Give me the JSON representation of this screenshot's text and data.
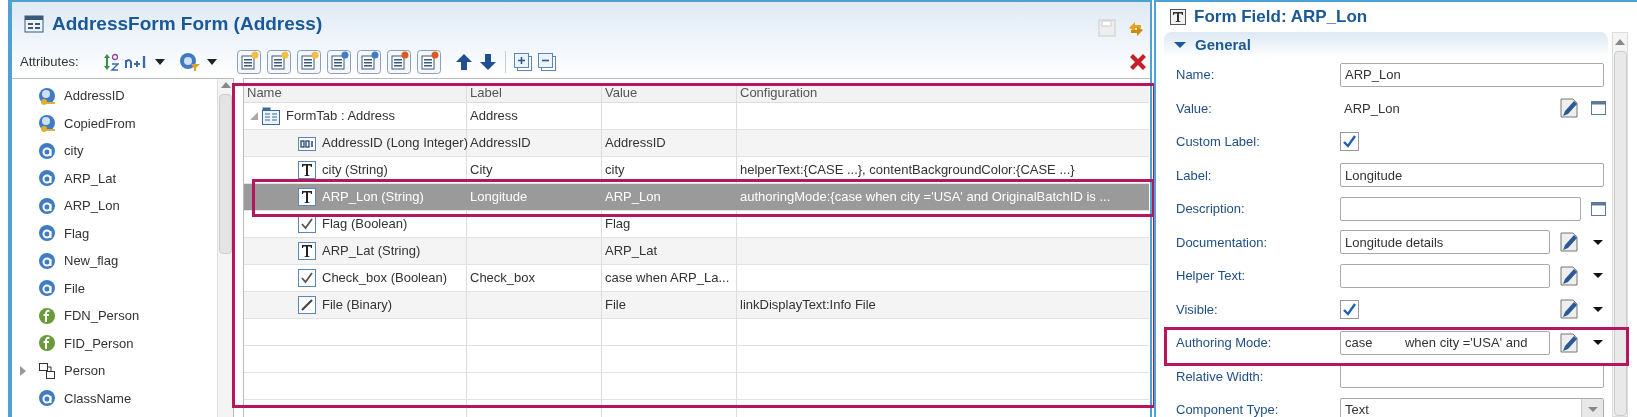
{
  "editor": {
    "title": "AddressForm Form (Address)",
    "attributes_label": "Attributes:"
  },
  "attributes": [
    {
      "name": "AddressID",
      "kind": "key",
      "expandable": false
    },
    {
      "name": "CopiedFrom",
      "kind": "key",
      "expandable": false
    },
    {
      "name": "city",
      "kind": "attribute",
      "expandable": false
    },
    {
      "name": "ARP_Lat",
      "kind": "attribute",
      "expandable": false
    },
    {
      "name": "ARP_Lon",
      "kind": "attribute",
      "expandable": false
    },
    {
      "name": "Flag",
      "kind": "attribute",
      "expandable": false
    },
    {
      "name": "New_flag",
      "kind": "attribute",
      "expandable": false
    },
    {
      "name": "File",
      "kind": "attribute",
      "expandable": false
    },
    {
      "name": "FDN_Person",
      "kind": "formula",
      "expandable": false
    },
    {
      "name": "FID_Person",
      "kind": "formula",
      "expandable": false
    },
    {
      "name": "Person",
      "kind": "relation",
      "expandable": true
    },
    {
      "name": "ClassName",
      "kind": "attribute",
      "expandable": false
    }
  ],
  "grid": {
    "columns": [
      "Name",
      "Label",
      "Value",
      "Configuration"
    ],
    "rows": [
      {
        "name": "FormTab : Address",
        "label": "Address",
        "kind": "tab",
        "selected": false,
        "expanded": true,
        "children": [
          {
            "name": "AddressID (Long Integer)",
            "label": "AddressID",
            "value": "AddressID",
            "kind": "number",
            "selected": false
          },
          {
            "name": "city (String)",
            "label": "City",
            "value": "city",
            "configuration": "helperText:{CASE ...}, contentBackgroundColor:{CASE ...}",
            "kind": "text",
            "selected": false
          },
          {
            "name": "ARP_Lon (String)",
            "label": "Longitude",
            "value": "ARP_Lon",
            "configuration": "authoringMode:{case when city ='USA' and OriginalBatchID is ...",
            "kind": "text",
            "selected": true
          },
          {
            "name": "Flag (Boolean)",
            "value": "Flag",
            "kind": "boolean",
            "selected": false
          },
          {
            "name": "ARP_Lat (String)",
            "value": "ARP_Lat",
            "kind": "text",
            "selected": false
          },
          {
            "name": "Check_box (Boolean)",
            "label": "Check_box",
            "value": "case when ARP_La...",
            "kind": "boolean",
            "selected": false
          },
          {
            "name": "File (Binary)",
            "value": "File",
            "configuration": "linkDisplayText:Info File",
            "kind": "binary",
            "selected": false
          }
        ]
      }
    ]
  },
  "properties": {
    "title": "Form Field: ARP_Lon",
    "section": {
      "title": "General",
      "expanded": true
    },
    "fields": [
      {
        "label": "Name:",
        "kind": "input",
        "value": "ARP_Lon",
        "expression": false,
        "menu": false,
        "dialog": false
      },
      {
        "label": "Value:",
        "kind": "text",
        "value": "ARP_Lon",
        "expression": true,
        "menu": false,
        "dialog": true
      },
      {
        "label": "Custom Label:",
        "kind": "checkbox",
        "checked": true,
        "expression": false,
        "menu": false,
        "dialog": false
      },
      {
        "label": "Label:",
        "kind": "input",
        "value": "Longitude",
        "expression": false,
        "menu": false,
        "dialog": false
      },
      {
        "label": "Description:",
        "kind": "input",
        "expression": false,
        "menu": false,
        "dialog": true
      },
      {
        "label": "Documentation:",
        "kind": "input",
        "value": "Longitude details",
        "expression": true,
        "menu": true,
        "dialog": false
      },
      {
        "label": "Helper Text:",
        "kind": "input",
        "expression": true,
        "menu": true,
        "dialog": false
      },
      {
        "label": "Visible:",
        "kind": "checkbox",
        "checked": true,
        "expression": true,
        "menu": true,
        "dialog": false
      },
      {
        "label": "Authoring Mode:",
        "kind": "input",
        "value": "case         when city ='USA' and",
        "expression": true,
        "menu": true,
        "dialog": false
      },
      {
        "label": "Relative Width:",
        "kind": "input",
        "expression": false,
        "menu": false,
        "dialog": false
      },
      {
        "label": "Component Type:",
        "kind": "select",
        "value": "Text",
        "expression": false,
        "menu": false,
        "dialog": false
      }
    ]
  }
}
